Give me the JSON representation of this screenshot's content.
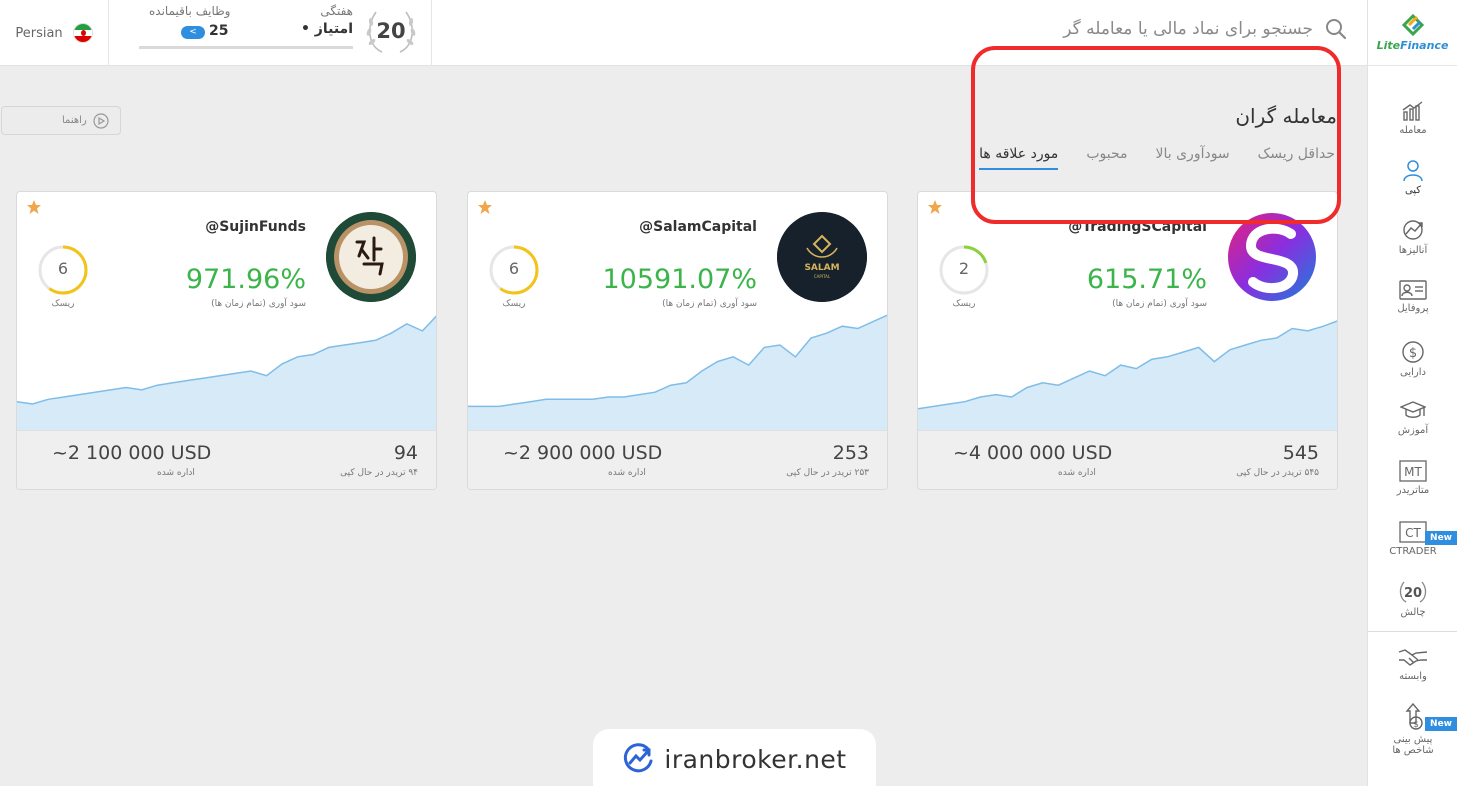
{
  "header": {
    "language": "Persian",
    "weekly": {
      "label": "هفتگی",
      "medal_number": "20",
      "points_label": "• امتیاز"
    },
    "tasks": {
      "label": "وظایف باقیمانده",
      "count": "25"
    },
    "search_placeholder": "جستجو برای نماد مالی یا معامله گر"
  },
  "sidebar": {
    "brand": {
      "lite": "Lite",
      "finance": "Finance"
    },
    "items": [
      {
        "label": "معامله",
        "icon": "trade-chart-icon"
      },
      {
        "label": "کپی",
        "icon": "copy-user-icon",
        "active": true
      },
      {
        "label": "آنالیزها",
        "icon": "analytics-icon"
      },
      {
        "label": "پروفایل",
        "icon": "profile-card-icon"
      },
      {
        "label": "دارایی",
        "icon": "dollar-icon"
      },
      {
        "label": "آموزش",
        "icon": "graduation-cap-icon"
      },
      {
        "label": "متاتریدر",
        "icon": "metatrader-icon",
        "glyph": "MT"
      },
      {
        "label": "CTRADER",
        "icon": "ctrader-icon",
        "glyph": "CT",
        "badge": "New"
      },
      {
        "label": "چالش",
        "icon": "challenge-medal-icon",
        "glyph": "20"
      },
      {
        "label": "وابسته",
        "icon": "handshake-icon"
      },
      {
        "label": "پیش بینی شاخص ها",
        "icon": "forecast-icon",
        "badge": "New"
      }
    ]
  },
  "main": {
    "guide_label": "راهنما",
    "title": "معامله گران",
    "tabs": [
      {
        "label": "مورد علاقه ها",
        "active": true
      },
      {
        "label": "محبوب"
      },
      {
        "label": "سودآوری بالا"
      },
      {
        "label": "حداقل ریسک"
      }
    ]
  },
  "cards": [
    {
      "handle": "@TradingSCapital",
      "profit": "615.71%",
      "profit_label": "سود آوری (تمام زمان ها)",
      "risk": 2,
      "risk_label": "ریسک",
      "risk_color": "#8bd23a",
      "traders": "545",
      "traders_label": "۵۴۵ تریدر در حال کپی",
      "managed": "~4 000 000 USD",
      "managed_label": "اداره شده",
      "curve": [
        0.18,
        0.2,
        0.22,
        0.24,
        0.28,
        0.3,
        0.28,
        0.36,
        0.4,
        0.38,
        0.44,
        0.5,
        0.46,
        0.55,
        0.52,
        0.6,
        0.62,
        0.66,
        0.7,
        0.58,
        0.68,
        0.72,
        0.76,
        0.78,
        0.86,
        0.84,
        0.88,
        0.93
      ]
    },
    {
      "handle": "@SalamCapital",
      "profit": "10591.07%",
      "profit_label": "سود آوری (تمام زمان ها)",
      "risk": 6,
      "risk_label": "ریسک",
      "risk_color": "#f2c318",
      "traders": "253",
      "traders_label": "۲۵۳ تریدر در حال کپی",
      "managed": "~2 900 000 USD",
      "managed_label": "اداره شده",
      "curve": [
        0.2,
        0.2,
        0.2,
        0.22,
        0.24,
        0.26,
        0.26,
        0.26,
        0.26,
        0.28,
        0.28,
        0.3,
        0.32,
        0.38,
        0.4,
        0.5,
        0.58,
        0.62,
        0.55,
        0.7,
        0.72,
        0.62,
        0.78,
        0.82,
        0.88,
        0.86,
        0.92,
        0.98
      ]
    },
    {
      "handle": "@SujinFunds",
      "profit": "971.96%",
      "profit_label": "سود آوری (تمام زمان ها)",
      "risk": 6,
      "risk_label": "ریسک",
      "risk_color": "#f2c318",
      "traders": "94",
      "traders_label": "۹۴ تریدر در حال کپی",
      "managed": "~2 100 000 USD",
      "managed_label": "اداره شده",
      "curve": [
        0.24,
        0.22,
        0.26,
        0.28,
        0.3,
        0.32,
        0.34,
        0.36,
        0.34,
        0.38,
        0.4,
        0.42,
        0.44,
        0.46,
        0.48,
        0.5,
        0.46,
        0.56,
        0.62,
        0.64,
        0.7,
        0.72,
        0.74,
        0.76,
        0.82,
        0.9,
        0.84,
        0.98
      ]
    }
  ],
  "watermark": {
    "text": "iranbroker.net"
  }
}
